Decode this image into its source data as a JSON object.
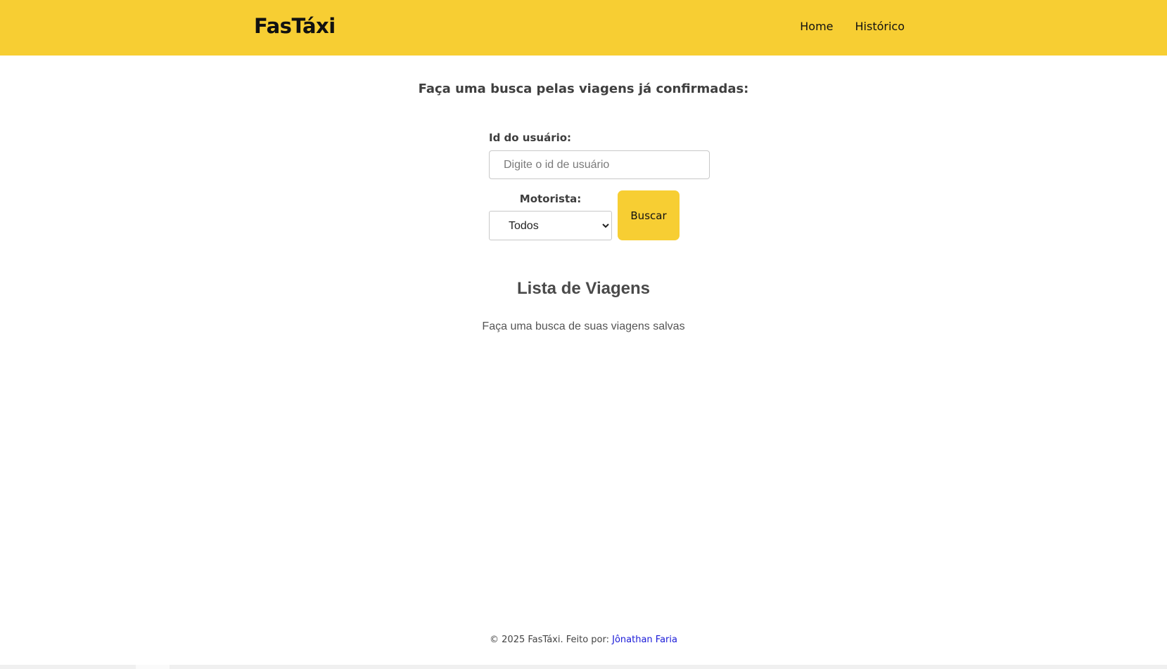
{
  "header": {
    "logo": "FasTáxi",
    "nav": [
      {
        "label": "Home"
      },
      {
        "label": "Histórico"
      }
    ]
  },
  "search": {
    "title": "Faça uma busca pelas viagens já confirmadas:",
    "user_id_label": "Id do usuário:",
    "user_id_placeholder": "Digite o id de usuário",
    "user_id_value": "",
    "driver_label": "Motorista:",
    "driver_selected": "Todos",
    "button_label": "Buscar"
  },
  "trips": {
    "title": "Lista de Viagens",
    "empty_message": "Faça uma busca de suas viagens salvas"
  },
  "footer": {
    "text": "© 2025 FasTáxi. Feito por: ",
    "author": "Jônathan Faria"
  },
  "colors": {
    "brand_yellow": "#f7ce33",
    "link_blue": "#1a1ad8"
  }
}
